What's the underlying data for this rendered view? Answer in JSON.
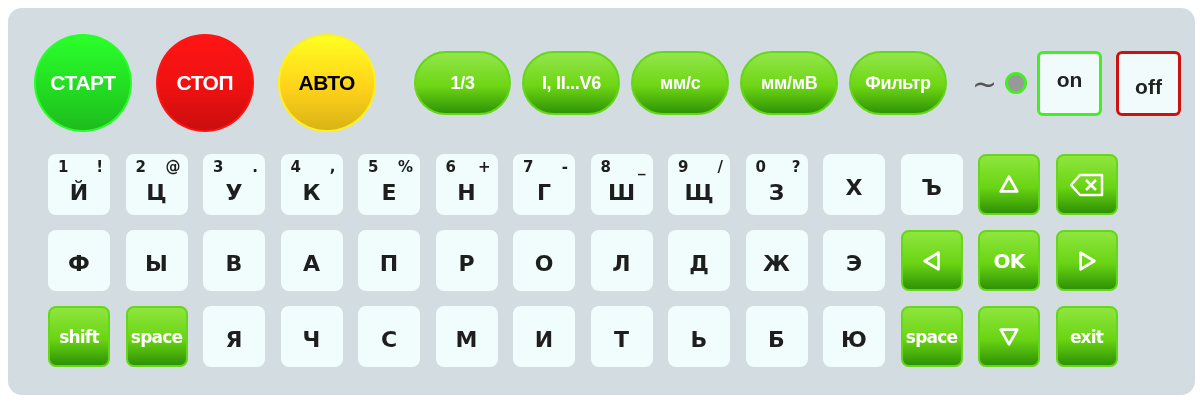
{
  "mode_buttons": [
    {
      "label": "СТАРТ",
      "color": "#22dd22"
    },
    {
      "label": "СТОП",
      "color": "#ee1111"
    },
    {
      "label": "АВТО",
      "color": "#ffd21a"
    }
  ],
  "option_buttons": [
    "1/3",
    "I, II...V6",
    "мм/с",
    "мм/мВ",
    "Фильтр"
  ],
  "indicator": {
    "symbol": "~",
    "lit": false
  },
  "toggles": [
    {
      "label": "on",
      "color": "#44ee22"
    },
    {
      "label": "off",
      "color": "#cc1111"
    }
  ],
  "keyboard": [
    [
      {
        "kind": "letter",
        "label": "Й",
        "digit": "1",
        "symbol": "!"
      },
      {
        "kind": "letter",
        "label": "Ц",
        "digit": "2",
        "symbol": "@"
      },
      {
        "kind": "letter",
        "label": "У",
        "digit": "3",
        "symbol": "."
      },
      {
        "kind": "letter",
        "label": "К",
        "digit": "4",
        "symbol": ","
      },
      {
        "kind": "letter",
        "label": "Е",
        "digit": "5",
        "symbol": "%"
      },
      {
        "kind": "letter",
        "label": "Н",
        "digit": "6",
        "symbol": "+"
      },
      {
        "kind": "letter",
        "label": "Г",
        "digit": "7",
        "symbol": "-"
      },
      {
        "kind": "letter",
        "label": "Ш",
        "digit": "8",
        "symbol": "_"
      },
      {
        "kind": "letter",
        "label": "Щ",
        "digit": "9",
        "symbol": "/"
      },
      {
        "kind": "letter",
        "label": "З",
        "digit": "0",
        "symbol": "?"
      },
      {
        "kind": "letter",
        "label": "Х"
      },
      {
        "kind": "letter",
        "label": "Ъ"
      },
      {
        "kind": "up"
      },
      {
        "kind": "backspace"
      }
    ],
    [
      {
        "kind": "letter",
        "label": "Ф"
      },
      {
        "kind": "letter",
        "label": "Ы"
      },
      {
        "kind": "letter",
        "label": "В"
      },
      {
        "kind": "letter",
        "label": "А"
      },
      {
        "kind": "letter",
        "label": "П"
      },
      {
        "kind": "letter",
        "label": "Р"
      },
      {
        "kind": "letter",
        "label": "О"
      },
      {
        "kind": "letter",
        "label": "Л"
      },
      {
        "kind": "letter",
        "label": "Д"
      },
      {
        "kind": "letter",
        "label": "Ж"
      },
      {
        "kind": "letter",
        "label": "Э"
      },
      {
        "kind": "left"
      },
      {
        "kind": "function",
        "label": "OK"
      },
      {
        "kind": "right"
      }
    ],
    [
      {
        "kind": "function",
        "label": "shift"
      },
      {
        "kind": "function",
        "label": "space"
      },
      {
        "kind": "letter",
        "label": "Я"
      },
      {
        "kind": "letter",
        "label": "Ч"
      },
      {
        "kind": "letter",
        "label": "С"
      },
      {
        "kind": "letter",
        "label": "М"
      },
      {
        "kind": "letter",
        "label": "И"
      },
      {
        "kind": "letter",
        "label": "Т"
      },
      {
        "kind": "letter",
        "label": "Ь"
      },
      {
        "kind": "letter",
        "label": "Б"
      },
      {
        "kind": "letter",
        "label": "Ю"
      },
      {
        "kind": "function",
        "label": "space"
      },
      {
        "kind": "down"
      },
      {
        "kind": "function",
        "label": "exit"
      }
    ]
  ]
}
